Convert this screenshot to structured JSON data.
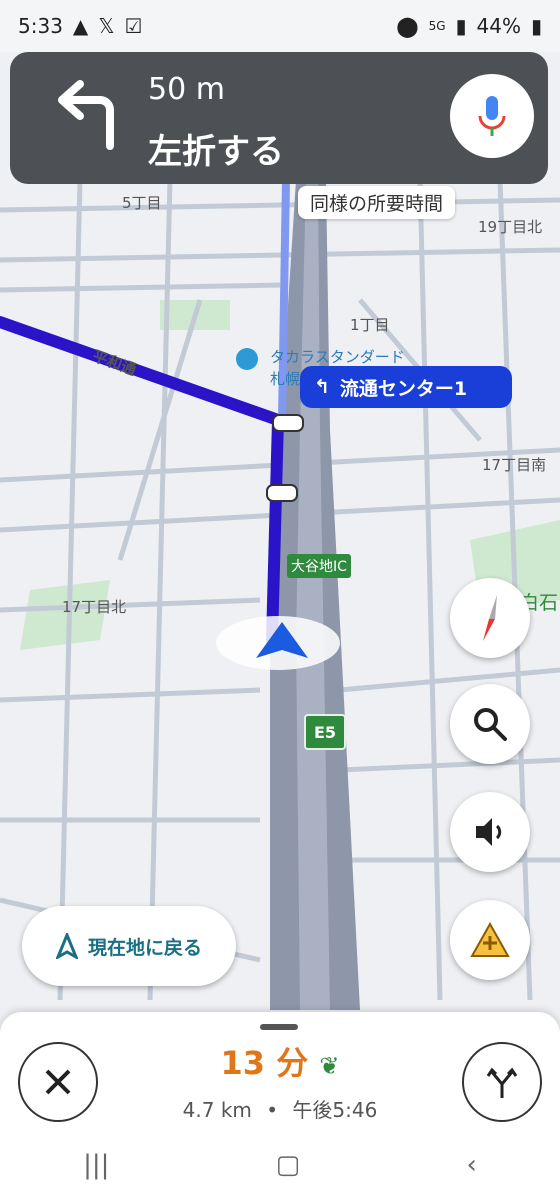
{
  "status": {
    "time": "5:33",
    "network": "5G",
    "battery": "44%",
    "left_icons": [
      "navigation-arrow-icon",
      "x-logo-icon",
      "check-square-icon"
    ],
    "right_icons": [
      "location-pin-icon",
      "5g-icon",
      "signal-icon",
      "battery-icon"
    ]
  },
  "banner": {
    "distance": "50 m",
    "instruction": "左折する"
  },
  "map": {
    "labels": {
      "block5": "5丁目",
      "block19n": "19丁目北",
      "block1": "1丁目",
      "heiwa": "平和通",
      "poi": "タカラスタンダード",
      "poi2": "札幌",
      "block17s": "17丁目南",
      "block17n": "17丁目北",
      "shiroishi": "白石",
      "ic": "大谷地IC",
      "e5": "E5"
    },
    "tooltip": "同様の所要時間",
    "next_turn": "流通センター1"
  },
  "buttons": {
    "return_label": "現在地に戻る"
  },
  "eta": {
    "duration": "13 分",
    "distance": "4.7 km",
    "separator": "•",
    "arrival": "午後5:46"
  },
  "colors": {
    "route": "#2b14c8",
    "banner": "#4d5156",
    "eta": "#e0761a",
    "next_turn_bg": "#1a3fd8",
    "highway": "#8e97aa"
  }
}
